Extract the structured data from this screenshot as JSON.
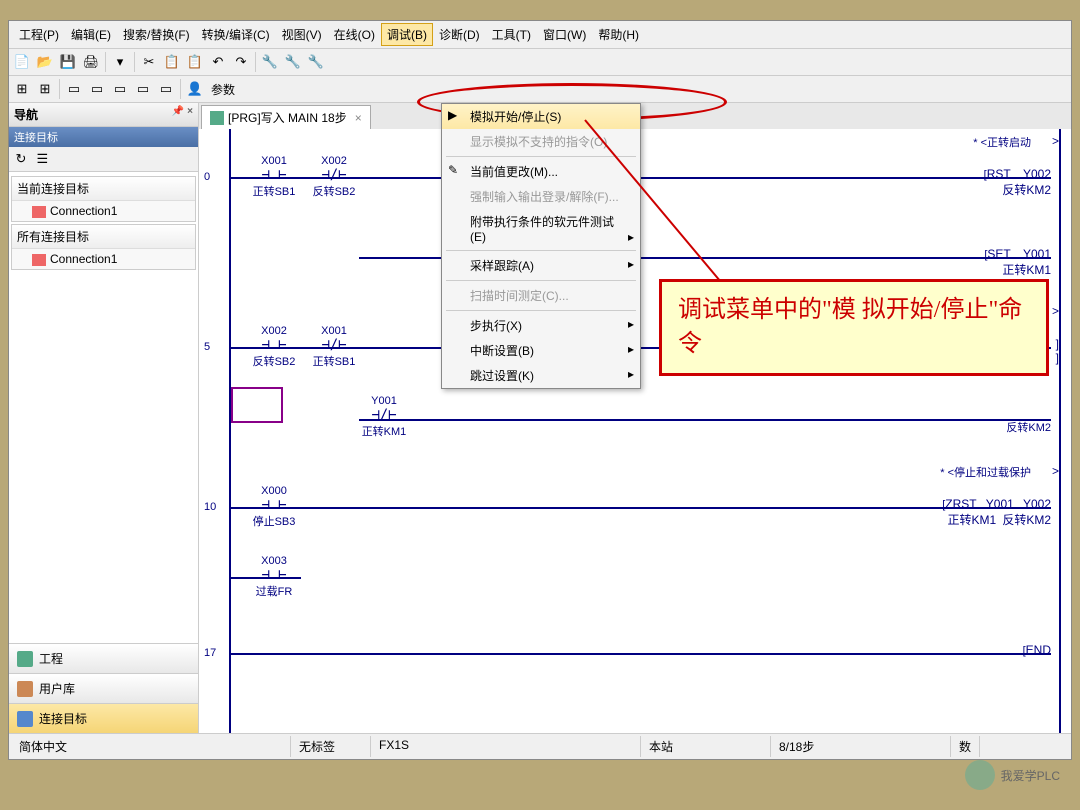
{
  "menu": {
    "items": [
      "工程(P)",
      "编辑(E)",
      "搜索/替换(F)",
      "转换/编译(C)",
      "视图(V)",
      "在线(O)",
      "调试(B)",
      "诊断(D)",
      "工具(T)",
      "窗口(W)",
      "帮助(H)"
    ]
  },
  "toolbar2_label": "参数",
  "sidebar": {
    "title": "导航",
    "pin": "📌 ×",
    "sub": "连接目标",
    "sec1": "当前连接目标",
    "item1": "Connection1",
    "sec2": "所有连接目标",
    "item2": "Connection1",
    "nav": [
      "工程",
      "用户库",
      "连接目标"
    ]
  },
  "tab": {
    "title": "[PRG]写入 MAIN 18步"
  },
  "dropdown": {
    "items": [
      {
        "t": "模拟开始/停止(S)",
        "hl": true
      },
      {
        "t": "显示模拟不支持的指令(O)",
        "dis": true,
        "sep": true
      },
      {
        "t": "当前值更改(M)..."
      },
      {
        "t": "强制输入输出登录/解除(F)...",
        "dis": true
      },
      {
        "t": "附带执行条件的软元件测试(E)",
        "arr": true,
        "sep": true
      },
      {
        "t": "采样跟踪(A)",
        "arr": true,
        "sep": true
      },
      {
        "t": "扫描时间测定(C)...",
        "dis": true,
        "sep": true
      },
      {
        "t": "步执行(X)",
        "arr": true
      },
      {
        "t": "中断设置(B)",
        "arr": true
      },
      {
        "t": "跳过设置(K)",
        "arr": true
      }
    ]
  },
  "ladder": {
    "steps": [
      "0",
      "5",
      "10",
      "17"
    ],
    "c": {
      "x001": "X001",
      "x002": "X002",
      "x000": "X000",
      "x003": "X003",
      "y001": "Y001",
      "sb1": "正转SB1",
      "sb2": "反转SB2",
      "sb3": "停止SB3",
      "fr": "过载FR",
      "km1": "正转KM1",
      "km2": "反转KM2"
    },
    "comments": {
      "fwd": "* <正转启动",
      "stop": "* <停止和过载保护"
    },
    "coils": {
      "rst": "RST",
      "y002": "Y002",
      "km2": "反转KM2",
      "set": "SET",
      "y001": "Y001",
      "km1": "正转KM1",
      "zrst": "ZRST",
      "end": "END"
    }
  },
  "status": {
    "lang": "简体中文",
    "tag": "无标签",
    "plc": "FX1S",
    "station": "本站",
    "step": "8/18步",
    "num": "数"
  },
  "callout": "调试菜单中的\"模\n拟开始/停止\"命令",
  "watermark": "我爱学PLC"
}
